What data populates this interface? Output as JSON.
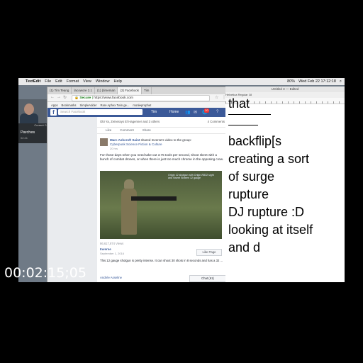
{
  "menubar": {
    "app": "TextEdit",
    "items": [
      "File",
      "Edit",
      "Format",
      "View",
      "Window",
      "Help"
    ],
    "clock": "Wed Feb 22  17:12:18",
    "battery": "80%"
  },
  "facetime": {
    "status": "Current Call",
    "name": "Parches",
    "duration": "02:41"
  },
  "browser": {
    "tabs": [
      "(1) Tim Teang",
      "lacowore 2.1",
      "(1) (timeman",
      "(2) Facebook",
      "Tim"
    ],
    "url_secure": "Secure",
    "url": "https://www.facebook.com",
    "bookmarks": [
      "Apps",
      "Bookmarks",
      "SimpleAdder",
      "Rare Aphex Twin ge...",
      "monk•prophet"
    ]
  },
  "facebook": {
    "search_placeholder": "Search Facebook",
    "user": "Tim",
    "home": "Home",
    "notif_count": "20",
    "reactions": "Obi Ya, Zeinerays El Hagenner and 3 others",
    "comments_count": "4 Comments",
    "actions": [
      "Like",
      "Comment",
      "Share"
    ],
    "post": {
      "author": "Marc Ashcroft Saint",
      "shared": "shared Inverse's video to the group:",
      "group": "Cyberpunk Science Fiction & Culture",
      "time": "20 hrs",
      "text": "For those days when you need take out 3.75 tools per second, shoot skeet with a bunch of combat drones, or when there is just too much chrome in the opposing crew.",
      "video_caption": "Origin 12 shotgun with Origin-R832 sight and Sweet Sixteen 12 gauge",
      "views": "86,617,874 Views",
      "shared_by": "Inverse",
      "shared_date": "September 1, 2016",
      "like_page": "Like Page",
      "description": "This 12 gauge shotgun is pretty intense. It can shoot 30 shots in 8 seconds and has a 32 ...",
      "commenter": "Andrée Asseline",
      "chat": "Chat (61)"
    }
  },
  "textedit": {
    "title": "Untitled 3 — Edited",
    "toolbar": "Helvetica   Regular   18",
    "lines": [
      "that",
      "backflip[s",
      "creating a sort",
      "of surge",
      "rupture",
      "DJ rupture :D",
      "looking at itself",
      "and d"
    ]
  },
  "timecode": "00:02:15;05"
}
